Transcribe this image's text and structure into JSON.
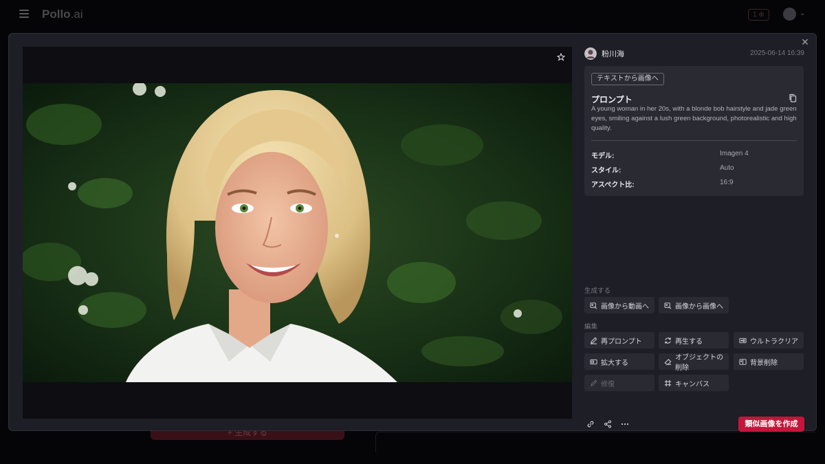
{
  "background": {
    "logo_main": "Pollo",
    "logo_suffix": ".ai",
    "credit_badge": "1 ⊕",
    "generate_button": "+ 生成する"
  },
  "modal": {
    "close_icon": "close-icon",
    "viewer": {
      "favorite_icon": "star-icon"
    },
    "author": {
      "name": "粉川海",
      "timestamp": "2025-06-14 16:39"
    },
    "info": {
      "mode_tag": "テキストから画像へ",
      "prompt_title": "プロンプト",
      "prompt_text": "A young woman in her 20s, with a blonde bob hairstyle and jade green eyes, smiling against a lush green background, photorealistic and high quality.",
      "specs": [
        {
          "label": "モデル:",
          "value": "Imagen 4"
        },
        {
          "label": "スタイル:",
          "value": "Auto"
        },
        {
          "label": "アスペクト比:",
          "value": "16:9"
        }
      ]
    },
    "generate_section": {
      "label": "生成する",
      "buttons": [
        {
          "label": "画像から動画へ",
          "icon": "image-video-icon"
        },
        {
          "label": "画像から画像へ",
          "icon": "image-image-icon"
        }
      ]
    },
    "edit_section": {
      "label": "編集",
      "buttons": [
        {
          "label": "再プロンプト",
          "icon": "pencil-icon"
        },
        {
          "label": "再生する",
          "icon": "refresh-icon"
        },
        {
          "label": "ウルトラクリア",
          "icon": "hd-icon"
        },
        {
          "label": "拡大する",
          "icon": "upscale-icon"
        },
        {
          "label": "オブジェクトの削除",
          "icon": "eraser-icon"
        },
        {
          "label": "背景削除",
          "icon": "remove-background-icon"
        },
        {
          "label": "修復",
          "icon": "brush-icon"
        },
        {
          "label": "キャンバス",
          "icon": "canvas-icon"
        }
      ]
    },
    "footer": {
      "link_icon": "link-icon",
      "share_icon": "share-icon",
      "more_icon": "more-icon",
      "create_similar": "類似画像を作成"
    }
  }
}
